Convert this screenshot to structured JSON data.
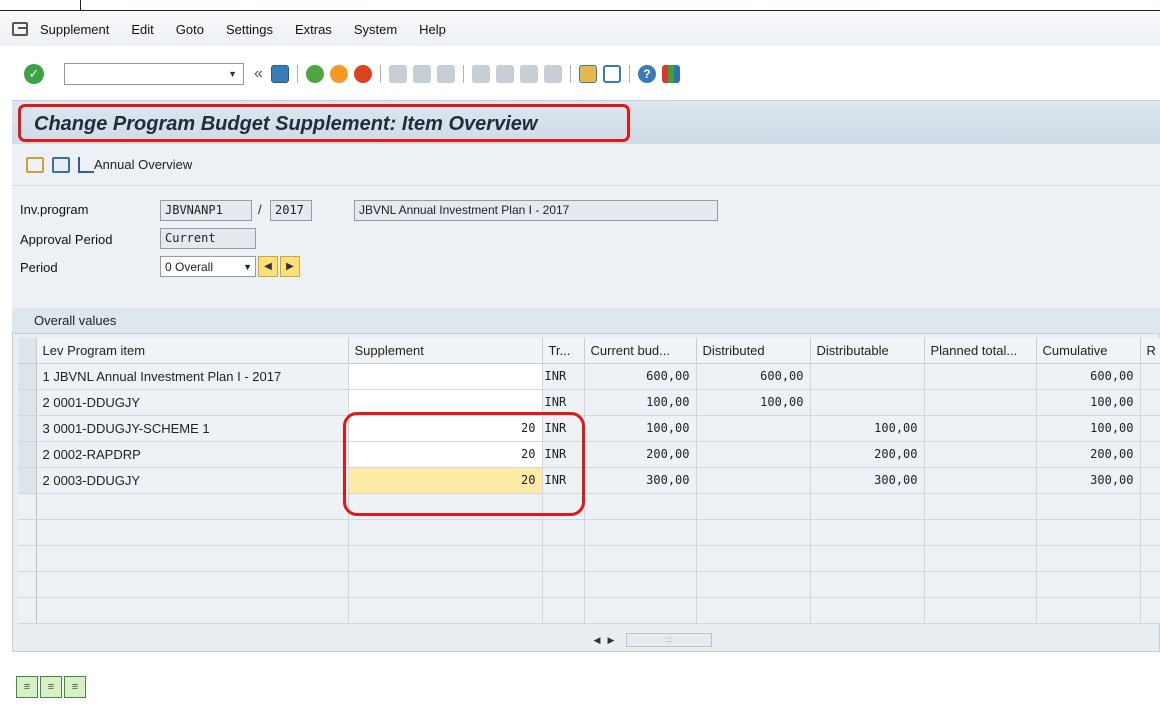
{
  "menu": {
    "items": [
      "Supplement",
      "Edit",
      "Goto",
      "Settings",
      "Extras",
      "System",
      "Help"
    ]
  },
  "toolbar": {
    "command_field_value": "",
    "icons": [
      "enter-icon",
      "save-icon",
      "back-icon",
      "exit-icon",
      "cancel-icon",
      "print-icon",
      "find-icon",
      "find-next-icon",
      "first-page-icon",
      "previous-page-icon",
      "next-page-icon",
      "last-page-icon",
      "create-session-icon",
      "shortcut-icon",
      "help-icon",
      "customize-layout-icon"
    ]
  },
  "title": "Change Program Budget Supplement: Item Overview",
  "app_toolbar": {
    "annual_overview_label": "Annual Overview"
  },
  "form": {
    "inv_program_label": "Inv.program",
    "inv_program_value": "JBVNANP1",
    "approval_year": "2017",
    "program_description": "JBVNL Annual Investment Plan I - 2017",
    "approval_period_label": "Approval Period",
    "approval_period_value": "Current",
    "period_label": "Period",
    "period_value": "0 Overall"
  },
  "table": {
    "caption": "Overall values",
    "columns": [
      "Lev Program item",
      "Supplement",
      "Tr...",
      "Current bud...",
      "Distributed",
      "Distributable",
      "Planned total...",
      "Cumulative",
      "R"
    ],
    "rows": [
      {
        "item": "1 JBVNL Annual Investment Plan I - 2017",
        "supplement": "",
        "currency": "INR",
        "current_budget": "600,00",
        "distributed": "600,00",
        "distributable": "",
        "planned_total": "",
        "cumulative": "600,00"
      },
      {
        "item": "2 0001-DDUGJY",
        "supplement": "",
        "currency": "INR",
        "current_budget": "100,00",
        "distributed": "100,00",
        "distributable": "",
        "planned_total": "",
        "cumulative": "100,00"
      },
      {
        "item": "3  0001-DDUGJY-SCHEME 1",
        "supplement": "20",
        "currency": "INR",
        "current_budget": "100,00",
        "distributed": "",
        "distributable": "100,00",
        "planned_total": "",
        "cumulative": "100,00"
      },
      {
        "item": "2 0002-RAPDRP",
        "supplement": "20",
        "currency": "INR",
        "current_budget": "200,00",
        "distributed": "",
        "distributable": "200,00",
        "planned_total": "",
        "cumulative": "200,00"
      },
      {
        "item": "2 0003-DDUGJY",
        "supplement": "20",
        "currency": "INR",
        "current_budget": "300,00",
        "distributed": "",
        "distributable": "300,00",
        "planned_total": "",
        "cumulative": "300,00"
      }
    ]
  },
  "colors": {
    "highlight": "#e01818",
    "focused_cell": "#fdeaa6"
  }
}
